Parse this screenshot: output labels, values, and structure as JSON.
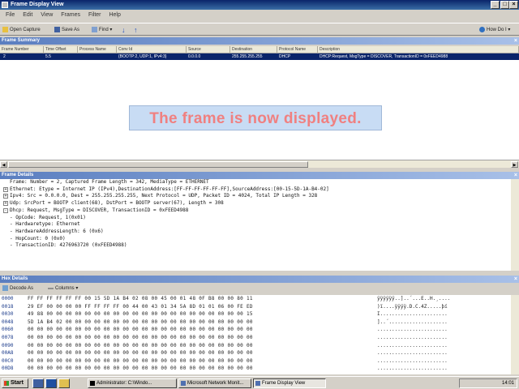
{
  "window": {
    "title": "Frame Display View"
  },
  "menu": [
    "File",
    "Edit",
    "View",
    "Frames",
    "Filter",
    "Help"
  ],
  "toolbar": {
    "open_capture": "Open Capture",
    "save_as": "Save As",
    "find": "Find",
    "how_do_i": "How Do I"
  },
  "summary": {
    "header": "Frame Summary",
    "columns": [
      "Frame Number",
      "Time Offset",
      "Process Name",
      "Conv Id",
      "Source",
      "Destination",
      "Protocol Name",
      "Description"
    ],
    "row": {
      "frame_number": "2",
      "time_offset": "5.5",
      "process_name": "",
      "conv_id": "{BOOTP:2, UDP:1, IPv4:3}",
      "source": "0.0.0.0",
      "destination": "255.255.255.255",
      "protocol": "DHCP",
      "description": "DHCP:Request, MsgType = DISCOVER, TransactionID = 0xFEED4988"
    }
  },
  "notice": "The frame is now displayed.",
  "details": {
    "header": "Frame Details",
    "lines": [
      {
        "toggle": "",
        "text": "Frame: Number = 2, Captured Frame Length = 342, MediaType = ETHERNET"
      },
      {
        "toggle": "+",
        "text": "Ethernet: Etype = Internet IP (IPv4),DestinationAddress:[FF-FF-FF-FF-FF-FF],SourceAddress:[00-15-5D-1A-B4-02]"
      },
      {
        "toggle": "+",
        "text": "Ipv4: Src = 0.0.0.0, Dest = 255.255.255.255, Next Protocol = UDP, Packet ID = 4024, Total IP Length = 328"
      },
      {
        "toggle": "+",
        "text": "Udp: SrcPort = BOOTP client(68), DstPort = BOOTP server(67), Length = 308"
      },
      {
        "toggle": "-",
        "text": "Dhcp: Request, MsgType = DISCOVER, TransactionID = 0xFEED4988"
      },
      {
        "toggle": "",
        "text": "  - OpCode: Request, 1(0x01)"
      },
      {
        "toggle": "",
        "text": "  - Hardwaretype: Ethernet"
      },
      {
        "toggle": "",
        "text": "  - HardwareAddressLength: 6 (0x6)"
      },
      {
        "toggle": "",
        "text": "  - HopCount: 0 (0x0)"
      },
      {
        "toggle": "",
        "text": "  - TransactionID: 4276963720 (0xFEED4988)"
      }
    ]
  },
  "hex": {
    "header": "Hex Details",
    "decode_as": "Decode As",
    "columns": "Columns",
    "rows": [
      {
        "offset": "0000",
        "bytes": "FF FF FF FF FF FF 00 15 5D 1A B4 02 08 00 45 00 01 48 0F B8 00 00 80 11",
        "ascii": "ÿÿÿÿÿÿ..]..´...E..H.¸...."
      },
      {
        "offset": "0018",
        "bytes": "29 EF 00 00 00 00 FF FF FF FF 00 44 00 43 01 34 5A 8D 01 01 06 00 FE ED",
        "ascii": ")ï....ÿÿÿÿ.D.C.4Z.....þí"
      },
      {
        "offset": "0030",
        "bytes": "49 88 00 00 00 00 00 00 00 00 00 00 00 00 00 00 00 00 00 00 00 00 00 15",
        "ascii": "I......................."
      },
      {
        "offset": "0048",
        "bytes": "5D 1A B4 02 00 00 00 00 00 00 00 00 00 00 00 00 00 00 00 00 00 00 00 00",
        "ascii": "]..´...................."
      },
      {
        "offset": "0060",
        "bytes": "00 00 00 00 00 00 00 00 00 00 00 00 00 00 00 00 00 00 00 00 00 00 00 00",
        "ascii": "........................"
      },
      {
        "offset": "0078",
        "bytes": "00 00 00 00 00 00 00 00 00 00 00 00 00 00 00 00 00 00 00 00 00 00 00 00",
        "ascii": "........................"
      },
      {
        "offset": "0090",
        "bytes": "00 00 00 00 00 00 00 00 00 00 00 00 00 00 00 00 00 00 00 00 00 00 00 00",
        "ascii": "........................"
      },
      {
        "offset": "00A8",
        "bytes": "00 00 00 00 00 00 00 00 00 00 00 00 00 00 00 00 00 00 00 00 00 00 00 00",
        "ascii": "........................"
      },
      {
        "offset": "00C0",
        "bytes": "00 00 00 00 00 00 00 00 00 00 00 00 00 00 00 00 00 00 00 00 00 00 00 00",
        "ascii": "........................"
      },
      {
        "offset": "00D8",
        "bytes": "00 00 00 00 00 00 00 00 00 00 00 00 00 00 00 00 00 00 00 00 00 00 00 00",
        "ascii": "........................"
      }
    ]
  },
  "taskbar": {
    "start": "Start",
    "tasks": [
      "Administrator: C:\\Windo...",
      "Microsoft Network Monit...",
      "Frame Display View"
    ],
    "clock": "14:01"
  },
  "colors": {
    "title_bar": "#0a246a",
    "notice_text": "#f08080",
    "notice_bg": "#c8dcf4",
    "selection": "#0a246a"
  }
}
